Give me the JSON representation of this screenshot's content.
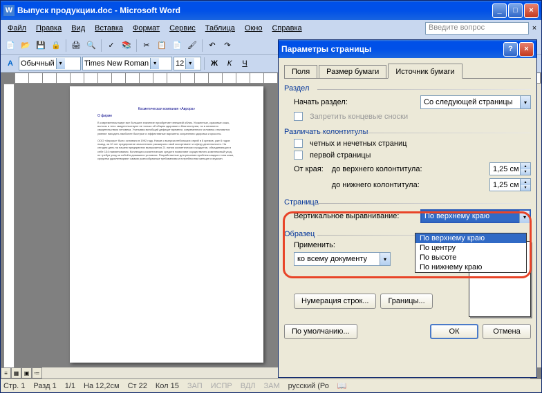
{
  "window": {
    "title": "Выпуск продукции.doc - Microsoft Word",
    "app_icon": "W"
  },
  "menu": [
    "Файл",
    "Правка",
    "Вид",
    "Вставка",
    "Формат",
    "Сервис",
    "Таблица",
    "Окно",
    "Справка"
  ],
  "ask_placeholder": "Введите вопрос",
  "format_bar": {
    "style": "Обычный",
    "font": "Times New Roman",
    "size": "12",
    "bold": "Ж",
    "italic": "К",
    "underline": "Ч"
  },
  "page": {
    "subtitle": "Косметическая компания «Аврора»",
    "heading": "О фирме"
  },
  "statusbar": {
    "page": "Стр. 1",
    "section": "Разд 1",
    "pages": "1/1",
    "pos": "На 12,2см",
    "line": "Ст 22",
    "col": "Кол 15",
    "rec": "ЗАП",
    "trk": "ИСПР",
    "ext": "ВДЛ",
    "ovr": "ЗАМ",
    "lang": "русский (Ро"
  },
  "dialog": {
    "title": "Параметры страницы",
    "tabs": [
      "Поля",
      "Размер бумаги",
      "Источник бумаги"
    ],
    "active_tab": 2,
    "section": {
      "label": "Раздел",
      "start_label": "Начать раздел:",
      "start_value": "Со следующей страницы",
      "suppress": "Запретить концевые сноски"
    },
    "headers": {
      "label": "Различать колонтитулы",
      "odd_even": "четных и нечетных страниц",
      "first_page": "первой страницы",
      "from_edge": "От края:",
      "to_header": "до верхнего колонтитула:",
      "to_footer": "до нижнего колонтитула:",
      "header_val": "1,25 см",
      "footer_val": "1,25 см"
    },
    "page_group": {
      "label": "Страница",
      "valign_label": "Вертикальное выравнивание:",
      "valign_value": "По верхнему краю",
      "valign_options": [
        "По верхнему краю",
        "По центру",
        "По высоте",
        "По нижнему краю"
      ]
    },
    "sample": {
      "label": "Образец",
      "apply_label": "Применить:",
      "apply_value": "ко всему документу"
    },
    "buttons": {
      "line_numbers": "Нумерация строк...",
      "borders": "Границы...",
      "default": "По умолчанию...",
      "ok": "ОК",
      "cancel": "Отмена"
    }
  },
  "tooltip": "?"
}
